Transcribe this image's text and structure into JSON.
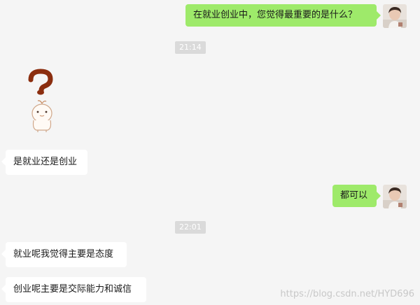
{
  "messages": [
    {
      "sender": "me",
      "text": "在就业创业中，您觉得最重要的是什么？"
    },
    {
      "time": "21:14"
    },
    {
      "sender": "them",
      "type": "sticker",
      "sticker": "question-mark-sticker"
    },
    {
      "sender": "them",
      "text": "是就业还是创业"
    },
    {
      "sender": "me",
      "text": "都可以"
    },
    {
      "time": "22:01"
    },
    {
      "sender": "them",
      "text": "就业呢我觉得主要是态度"
    },
    {
      "sender": "them",
      "text": "创业呢主要是交际能力和诚信"
    }
  ],
  "watermark": "https://blog.csdn.net/HYD696",
  "colors": {
    "background": "#f5f5f5",
    "my_bubble": "#9eea6a",
    "their_bubble": "#ffffff",
    "time_badge": "#dadada"
  },
  "icons": {
    "avatar": "user-avatar-photo",
    "sticker": "question-mark-sticker"
  }
}
